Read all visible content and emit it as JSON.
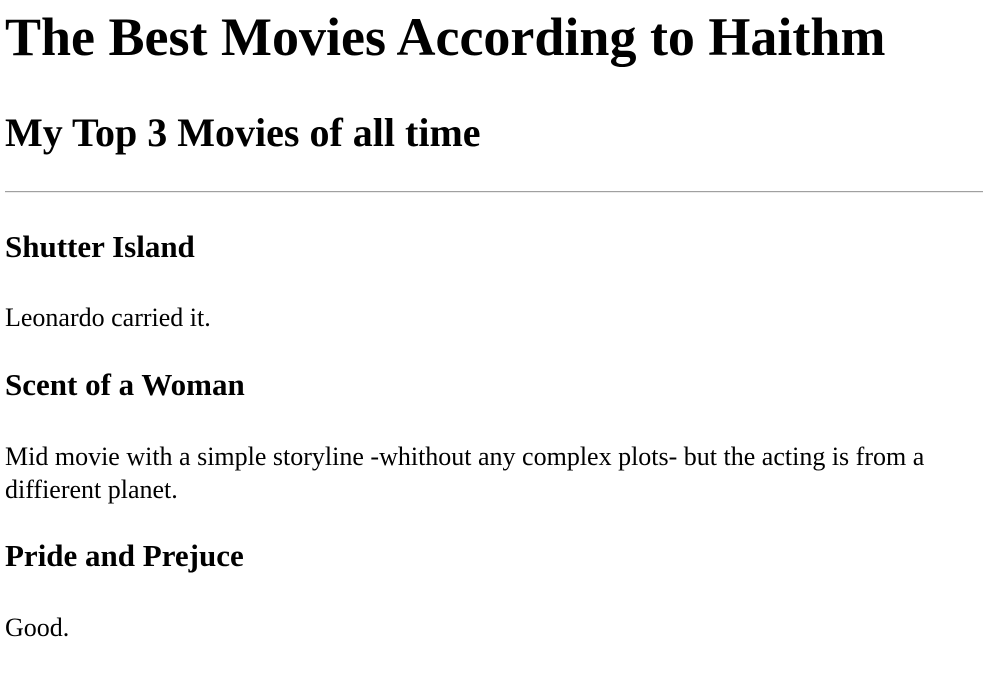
{
  "header": {
    "title": "The Best Movies According to Haithm",
    "subtitle": "My Top 3 Movies of all time"
  },
  "movies": [
    {
      "title": "Shutter Island",
      "description": "Leonardo carried it."
    },
    {
      "title": "Scent of a Woman",
      "description": "Mid movie with a simple storyline -whithout any complex plots- but the acting is from a diffierent planet."
    },
    {
      "title": "Pride and Prejuce",
      "description": "Good."
    }
  ]
}
